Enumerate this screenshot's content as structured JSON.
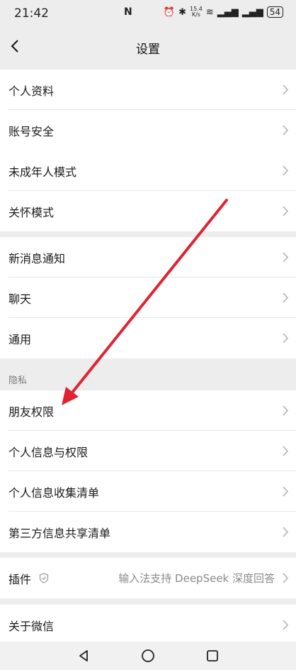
{
  "status": {
    "time": "21:42",
    "nfc": "N",
    "speed_value": "15.4",
    "speed_unit": "K/s",
    "battery": "54"
  },
  "navbar": {
    "title": "设置"
  },
  "rows": {
    "profile": "个人资料",
    "account_security": "账号安全",
    "minor_mode": "未成年人模式",
    "care_mode": "关怀模式",
    "notifications": "新消息通知",
    "chat": "聊天",
    "general": "通用",
    "friend_permissions": "朋友权限",
    "personal_info_permissions": "个人信息与权限",
    "personal_info_collection": "个人信息收集清单",
    "third_party_sharing": "第三方信息共享清单",
    "plugins": "插件",
    "plugins_value": "输入法支持 DeepSeek 深度回答",
    "about": "关于微信"
  },
  "sections": {
    "privacy": "隐私"
  },
  "annotation": {
    "arrow_color": "#e02331"
  },
  "icons": [
    "back-icon",
    "chevron-right-icon",
    "shield-icon",
    "triangle-back-icon",
    "circle-home-icon",
    "square-recents-icon"
  ]
}
